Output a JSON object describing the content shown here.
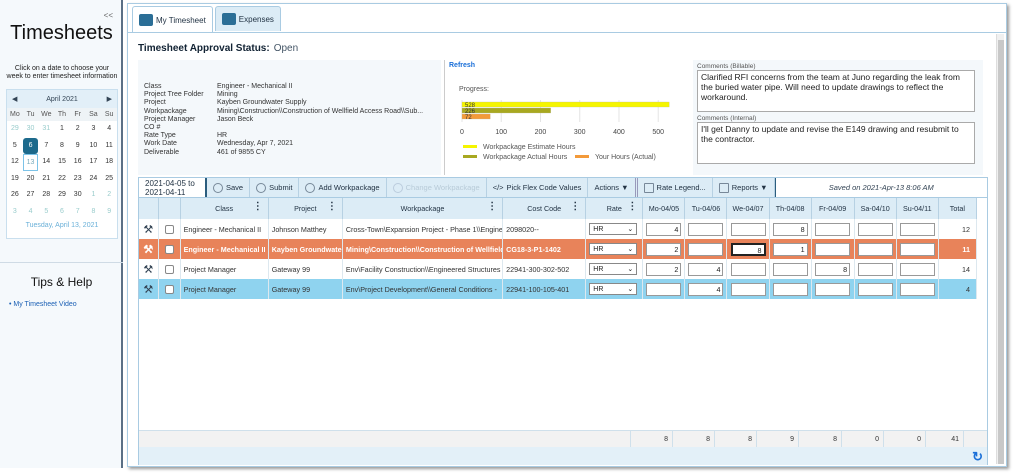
{
  "sidebar": {
    "collapse": "<<",
    "title": "Timesheets",
    "hint": "Click on a date to choose your week to enter timesheet information",
    "calendar": {
      "month": "April 2021",
      "prev": "◀",
      "next": "▶",
      "dows": [
        "Mo",
        "Tu",
        "We",
        "Th",
        "Fr",
        "Sa",
        "Su"
      ],
      "days": [
        [
          "29",
          "30",
          "31",
          "1",
          "2",
          "3",
          "4"
        ],
        [
          "5",
          "6",
          "7",
          "8",
          "9",
          "10",
          "11"
        ],
        [
          "12",
          "13",
          "14",
          "15",
          "16",
          "17",
          "18"
        ],
        [
          "19",
          "20",
          "21",
          "22",
          "23",
          "24",
          "25"
        ],
        [
          "26",
          "27",
          "28",
          "29",
          "30",
          "1",
          "2"
        ],
        [
          "3",
          "4",
          "5",
          "6",
          "7",
          "8",
          "9"
        ]
      ],
      "selected": "6",
      "today": "13",
      "footer": "Tuesday, April 13, 2021"
    },
    "tips_title": "Tips & Help",
    "tips_link": "My Timesheet Video"
  },
  "tabs": [
    {
      "label": "My Timesheet"
    },
    {
      "label": "Expenses"
    }
  ],
  "status": {
    "label": "Timesheet Approval Status:",
    "value": "Open"
  },
  "info": [
    [
      "Class",
      "Engineer - Mechanical II"
    ],
    [
      "Project Tree Folder",
      "Mining"
    ],
    [
      "Project",
      "Kayben Groundwater Supply"
    ],
    [
      "Workpackage",
      "Mining\\Construction\\\\Construction of Wellfield Access Road\\\\Sub..."
    ],
    [
      "Project Manager",
      "Jason Beck"
    ],
    [
      "CO #",
      ""
    ],
    [
      "Rate Type",
      "HR"
    ],
    [
      "Work Date",
      "Wednesday, Apr 7, 2021"
    ],
    [
      "Deliverable",
      "461  of 9855 CY"
    ]
  ],
  "chart": {
    "refresh": "Refresh",
    "label": "Progress:",
    "xticks": [
      0,
      100,
      200,
      300,
      400,
      500
    ],
    "xmax": 530,
    "series": [
      {
        "name": "Workpackage Estimate Hours",
        "value": 528,
        "color": "#f5f500"
      },
      {
        "name": "Workpackage Actual Hours",
        "value": 226,
        "color": "#a8a820"
      },
      {
        "name": "Your Hours (Actual)",
        "value": 72,
        "color": "#f39a3a"
      }
    ]
  },
  "comments": {
    "billable_label": "Comments (Billable)",
    "billable": "Clarified RFI concerns from the team at Juno regarding the leak from the buried water pipe. Will need to update drawings to reflect the workaround.",
    "internal_label": "Comments (Internal)",
    "internal": "I'll get Danny to update and revise the E149 drawing and resubmit to the contractor."
  },
  "toolbar": {
    "date_range": "2021-04-05 to 2021-04-11",
    "save": "Save",
    "submit": "Submit",
    "add": "Add Workpackage",
    "change": "Change Workpackage",
    "flex": "Pick Flex Code Values",
    "actions": "Actions ▼",
    "rate_legend": "Rate Legend...",
    "reports": "Reports ▼",
    "saved": "Saved on 2021-Apr-13 8:06 AM"
  },
  "columns": [
    "Class",
    "Project",
    "Workpackage",
    "Cost Code",
    "Rate",
    "Mo-04/05",
    "Tu-04/06",
    "We-04/07",
    "Th-04/08",
    "Fr-04/09",
    "Sa-04/10",
    "Su-04/11",
    "Total"
  ],
  "rows": [
    {
      "class": "Engineer - Mechanical II",
      "project": "Johnson Matthey",
      "workpackage": "Cross-Town\\Expansion Project - Phase 1\\\\Engineering",
      "cost_code": "2098020--",
      "rate": "HR",
      "hours": [
        "4",
        "",
        "",
        "8",
        "",
        "",
        ""
      ],
      "total": "12",
      "style": ""
    },
    {
      "class": "Engineer - Mechanical II",
      "project": "Kayben Groundwater Supply",
      "workpackage": "Mining\\Construction\\\\Construction of Wellfield Access Road",
      "cost_code": "CG18-3-P1-1402",
      "rate": "HR",
      "hours": [
        "2",
        "",
        "8",
        "1",
        "",
        "",
        ""
      ],
      "total": "11",
      "style": "r-orange"
    },
    {
      "class": "Project Manager",
      "project": "Gateway 99",
      "workpackage": "Env\\Facility Construction\\\\Engineered Structures",
      "cost_code": "22941-300-302-502",
      "rate": "HR",
      "hours": [
        "2",
        "4",
        "",
        "",
        "8",
        "",
        ""
      ],
      "total": "14",
      "style": ""
    },
    {
      "class": "Project Manager",
      "project": "Gateway 99",
      "workpackage": "Env\\Project Development\\\\General Conditions - ",
      "cost_code": "22941-100-105-401",
      "rate": "HR",
      "hours": [
        "",
        "4",
        "",
        "",
        "",
        "",
        ""
      ],
      "total": "4",
      "style": "r-blue"
    }
  ],
  "totals": [
    "8",
    "8",
    "8",
    "9",
    "8",
    "0",
    "0",
    "41"
  ]
}
